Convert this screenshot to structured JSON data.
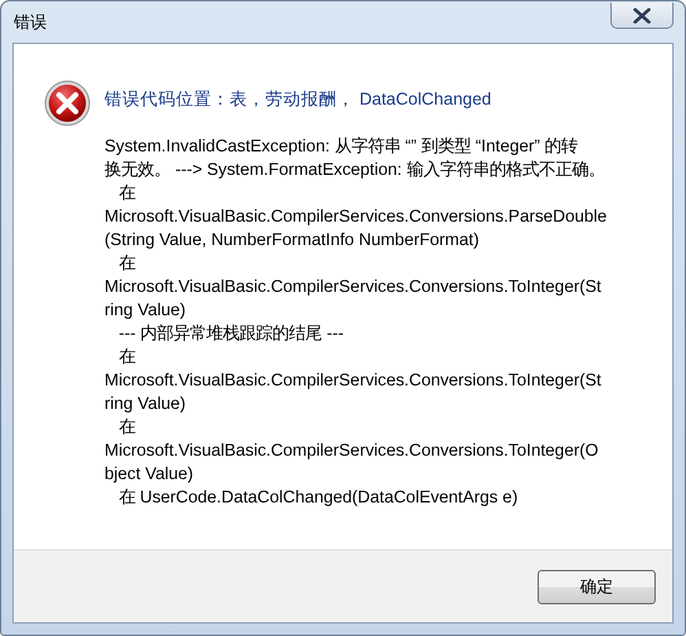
{
  "window": {
    "title": "错误"
  },
  "heading": "错误代码位置：表，劳动报酬， DataColChanged",
  "message_lines": [
    "System.InvalidCastException: 从字符串 “” 到类型 “Integer” 的转",
    "换无效。 ---> System.FormatException: 输入字符串的格式不正确。",
    "   在",
    "Microsoft.VisualBasic.CompilerServices.Conversions.ParseDouble",
    "(String Value, NumberFormatInfo NumberFormat)",
    "   在",
    "Microsoft.VisualBasic.CompilerServices.Conversions.ToInteger(St",
    "ring Value)",
    "   --- 内部异常堆栈跟踪的结尾 ---",
    "   在",
    "Microsoft.VisualBasic.CompilerServices.Conversions.ToInteger(St",
    "ring Value)",
    "   在",
    "Microsoft.VisualBasic.CompilerServices.Conversions.ToInteger(O",
    "bject Value)",
    "   在 UserCode.DataColChanged(DataColEventArgs e)"
  ],
  "buttons": [
    "确定"
  ]
}
